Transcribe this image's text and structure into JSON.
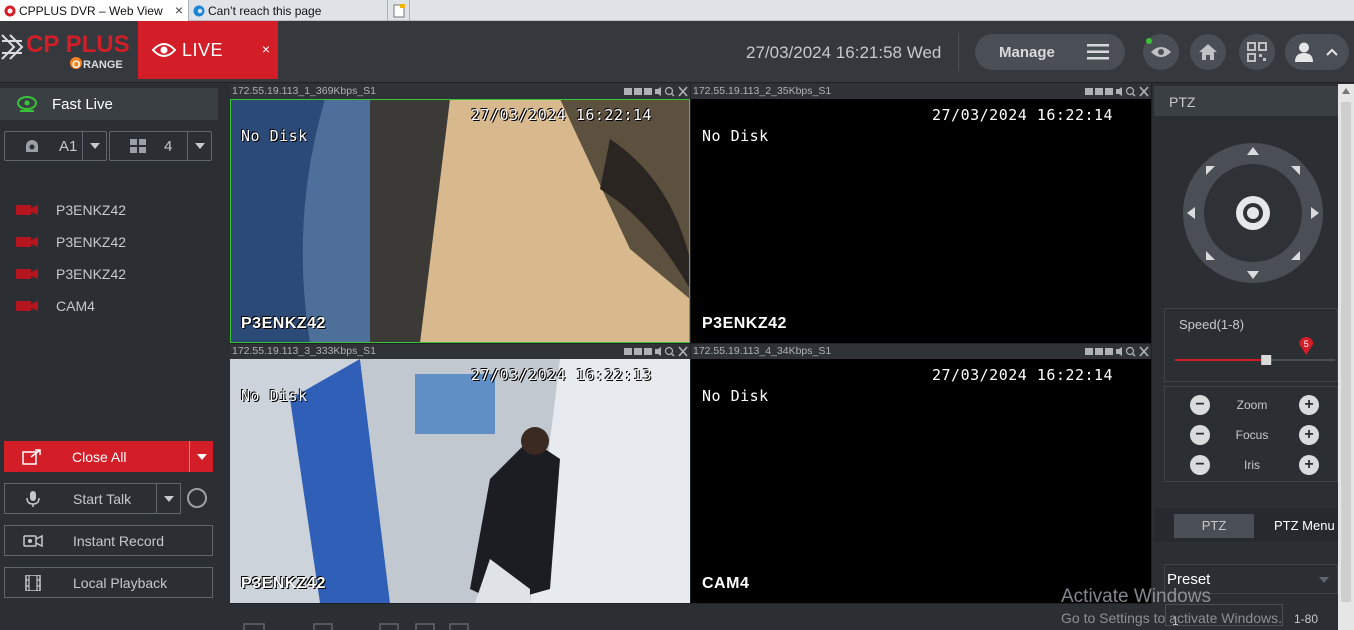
{
  "browser": {
    "tabs": [
      {
        "title": "CPPLUS DVR – Web View",
        "active": true
      },
      {
        "title": "Can’t reach this page",
        "active": false
      }
    ]
  },
  "header": {
    "live_label": "LIVE",
    "close_symbol": "×",
    "datetime": "27/03/2024 16:21:58 Wed",
    "manage_label": "Manage",
    "brand_colors": {
      "accent": "#d31d27",
      "orange": "#f58220"
    }
  },
  "left": {
    "fast_live": "Fast Live",
    "channel_select": "A1",
    "layout_select": "4",
    "cameras": [
      "P3ENKZ42",
      "P3ENKZ42",
      "P3ENKZ42",
      "CAM4"
    ],
    "close_all": "Close All",
    "start_talk": "Start Talk",
    "instant_record": "Instant Record",
    "local_playback": "Local Playback"
  },
  "tiles": [
    {
      "stream": "172.55.19.113_1_369Kbps_S1",
      "no_disk": "No Disk",
      "timestamp": "27/03/2024 16:22:14",
      "cam_name": "P3ENKZ42",
      "active": true
    },
    {
      "stream": "172.55.19.113_2_35Kbps_S1",
      "no_disk": "No Disk",
      "timestamp": "27/03/2024 16:22:14",
      "cam_name": "P3ENKZ42",
      "active": false
    },
    {
      "stream": "172.55.19.113_3_333Kbps_S1",
      "no_disk": "No Disk",
      "timestamp": "27/03/2024 16:22:13",
      "cam_name": "P3ENKZ42",
      "active": false
    },
    {
      "stream": "172.55.19.113_4_34Kbps_S1",
      "no_disk": "No Disk",
      "timestamp": "27/03/2024 16:22:14",
      "cam_name": "CAM4",
      "active": false
    }
  ],
  "ptz": {
    "title": "PTZ",
    "speed_label": "Speed(1-8)",
    "speed_value": "5",
    "speed_fraction": 0.57,
    "zoom": "Zoom",
    "focus": "Focus",
    "iris": "Iris",
    "tab_ptz": "PTZ",
    "tab_menu": "PTZ Menu",
    "preset": "Preset",
    "preset_value": "1",
    "preset_range": "1-80"
  },
  "watermark": {
    "line1": "Activate Windows",
    "line2": "Go to Settings to activate Windows."
  }
}
